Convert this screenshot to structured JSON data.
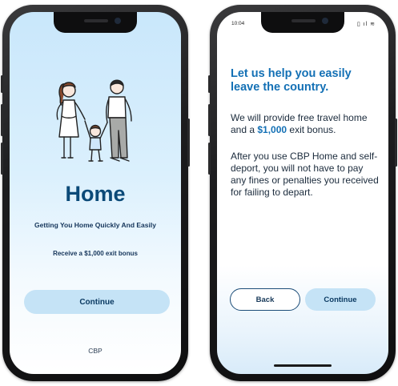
{
  "screen1": {
    "title": "Home",
    "tagline": "Getting You Home Quickly And Easily",
    "bonus_text": "Receive a $1,000 exit bonus",
    "continue_label": "Continue",
    "footer": "CBP"
  },
  "screen2": {
    "status_time": "10:04",
    "heading": "Let us help you easily leave the country.",
    "para1_before": "We will provide free travel home and a ",
    "para1_amount": "$1,000",
    "para1_after": " exit bonus.",
    "para2": "After you use CBP Home and self-deport, you will not have to pay any fines or penalties you received for failing to depart.",
    "back_label": "Back",
    "continue_label": "Continue"
  },
  "colors": {
    "brand_dark": "#0b4a78",
    "accent_blue": "#1370b5",
    "button_fill": "#c5e3f6"
  },
  "icons": [
    "family-illustration",
    "battery-icon",
    "signal-icon",
    "wifi-icon"
  ]
}
